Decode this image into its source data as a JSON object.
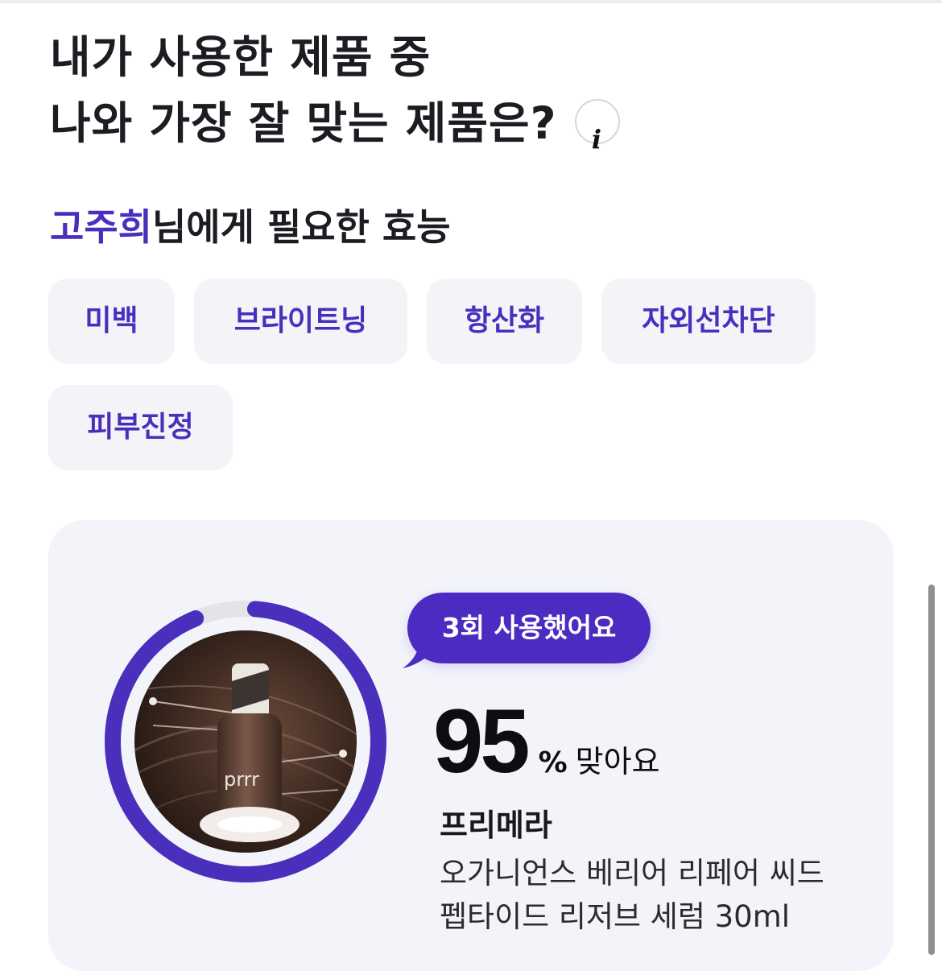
{
  "header": {
    "title_line1": "내가 사용한 제품 중",
    "title_line2": "나와 가장 잘 맞는 제품은?",
    "info_icon": "i"
  },
  "efficacy": {
    "user_name": "고주희",
    "title_suffix": "님에게 필요한 효능",
    "chips": [
      "미백",
      "브라이트닝",
      "항산화",
      "자외선차단",
      "피부진정"
    ]
  },
  "match_card": {
    "usage_badge": "3회 사용했어요",
    "match_percent": 95,
    "match_percent_text": "95",
    "match_unit": "%",
    "match_label": "맞아요",
    "brand": "프리메라",
    "product_name": "오가니언스 베리어 리페어 씨드 펩타이드 리저브 세럼 30ml",
    "product_image": "serum-bottle-photo",
    "bottle_label": "prrr",
    "ring_color": "#4a2fbd",
    "ring_track_color": "#e3e3e8"
  },
  "colors": {
    "accent": "#4a2fbd",
    "chip_bg": "#f3f3f8",
    "card_bg": "#f3f4fa"
  }
}
